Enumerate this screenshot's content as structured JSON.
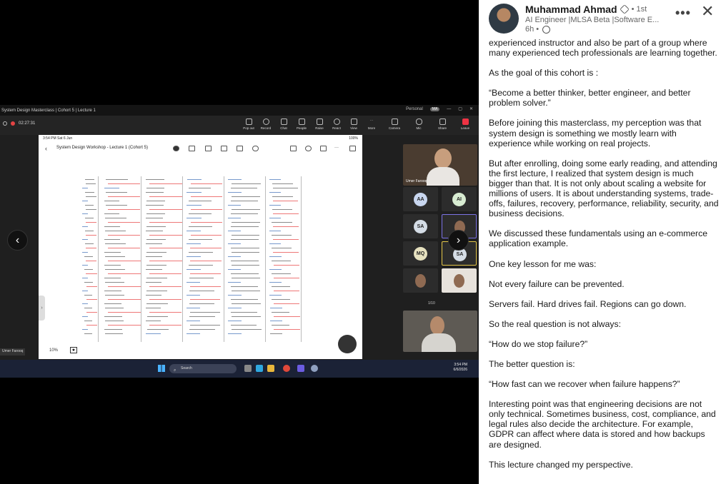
{
  "meeting": {
    "window_title": "System Design Masterclass | Cohort 5 | Lecture 1",
    "profile_label": "Personal",
    "profile_badge": "MA",
    "timer": "02:27:31",
    "controls": [
      "Pop out",
      "Record",
      "Chat",
      "People",
      "Raise",
      "React",
      "View",
      "More",
      "Camera",
      "Mic",
      "Share",
      "Leave"
    ],
    "ipad_time": "3:54 PM  Sat 6 Jun",
    "ipad_battery": "100%",
    "ipad_doc_title": "System Design Workshop - Lecture 1 (Cohort 5)",
    "zoom_level": "10%",
    "speaker_name": "Umer Farooq",
    "bottom_name": "Umer Farooq",
    "participants": [
      "AA",
      "AI",
      "SA",
      "MQ",
      "SA"
    ],
    "pager": "1/10",
    "taskbar_search": "Search",
    "clock_time": "3:54 PM",
    "clock_date": "6/6/2026",
    "colors": {
      "accent_purple": "#7c73e6",
      "accent_yellow": "#e6c84a",
      "leave_red": "#e34444"
    }
  },
  "post": {
    "author_name": "Muhammad Ahmad",
    "degree": "• 1st",
    "headline": "AI Engineer |MLSA Beta |Software E...",
    "time": "6h •",
    "paragraphs": [
      "experienced instructor and also be part of a group where many experienced tech professionals are learning together.",
      "As the goal of this cohort is :",
      "“Become a better thinker, better engineer, and better problem solver.”",
      "Before joining this masterclass, my perception was that system design is something we mostly learn with experience while working on real projects.",
      "But after enrolling, doing some early reading, and attending the first lecture, I realized that system design is much bigger than that. It is not only about scaling a website for millions of users. It is about understanding systems, trade-offs, failures, recovery, performance, reliability, security, and business decisions.",
      "We discussed these fundamentals using an e-commerce application example.",
      "One key lesson for me was:",
      "Not every failure can be prevented.",
      "Servers fail. Hard drives fail. Regions can go down.",
      "So the real question is not always:",
      "“How do we stop failure?”",
      "The better question is:",
      "“How fast can we recover when failure happens?”",
      "Interesting point was that engineering decisions are not only technical. Sometimes business, cost, compliance, and legal rules also decide the architecture. For example, GDPR can affect where data is stored and how backups are designed.",
      "This lecture changed my perspective."
    ]
  },
  "icons": {
    "prev": "‹",
    "next": "›",
    "more": "•••",
    "close": "✕"
  }
}
